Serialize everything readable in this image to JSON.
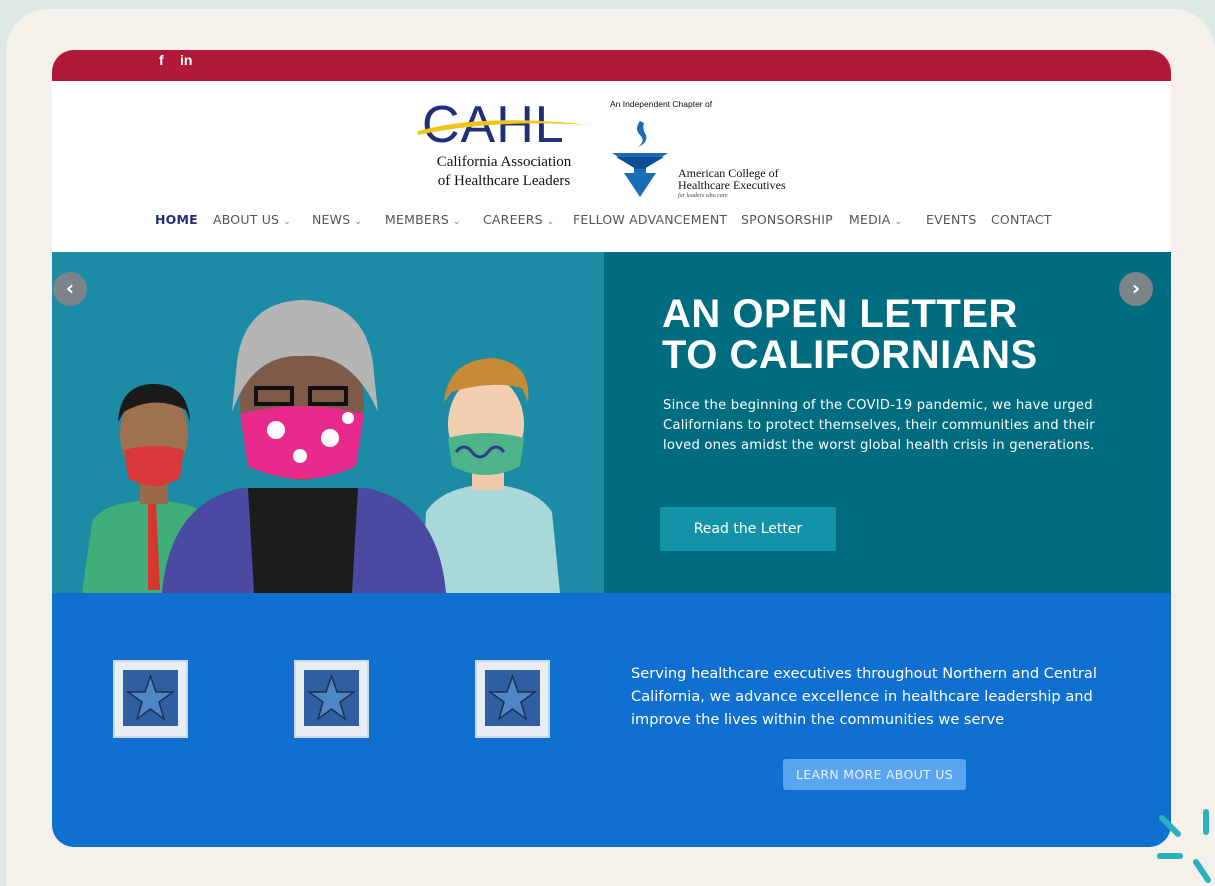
{
  "social": {
    "facebook": "f",
    "linkedin": "in"
  },
  "logo": {
    "cahl_word": "CAHL",
    "cahl_line1": "California Association",
    "cahl_line2": "of Healthcare Leaders",
    "ache_top": "An Independent Chapter of",
    "ache_line1": "American College of",
    "ache_line2": "Healthcare Executives",
    "ache_tag": "for leaders who care"
  },
  "nav": {
    "items": [
      {
        "label": "HOME"
      },
      {
        "label": "ABOUT US",
        "caret": "⌄"
      },
      {
        "label": "NEWS",
        "caret": "⌄"
      },
      {
        "label": "MEMBERS",
        "caret": "⌄"
      },
      {
        "label": "CAREERS",
        "caret": "⌄"
      },
      {
        "label": "FELLOW ADVANCEMENT"
      },
      {
        "label": "SPONSORSHIP"
      },
      {
        "label": "MEDIA",
        "caret": "⌄"
      },
      {
        "label": "EVENTS"
      },
      {
        "label": "CONTACT"
      }
    ]
  },
  "hero": {
    "title_line1": "AN OPEN LETTER",
    "title_line2": "TO CALIFORNIANS",
    "body": "Since the beginning of the COVID-19 pandemic, we have urged Californians to protect themselves, their communities and their loved ones amidst the worst global health crisis in generations.",
    "button": "Read the Letter",
    "prev_arrow": "‹",
    "next_arrow": "›"
  },
  "lower": {
    "text": "Serving healthcare executives throughout Northern and Central California, we advance excellence in healthcare leadership and improve the lives within the communities we serve",
    "button": "LEARN MORE ABOUT US"
  },
  "colors": {
    "topbar": "#b01a38",
    "navy": "#1f2f79",
    "hero_left": "#1c8ca6",
    "hero_right": "#006c80",
    "lower": "#1070d0"
  },
  "icons": [
    "facebook-icon",
    "linkedin-icon",
    "chevron-left-icon",
    "chevron-right-icon",
    "star-badge-icon"
  ]
}
